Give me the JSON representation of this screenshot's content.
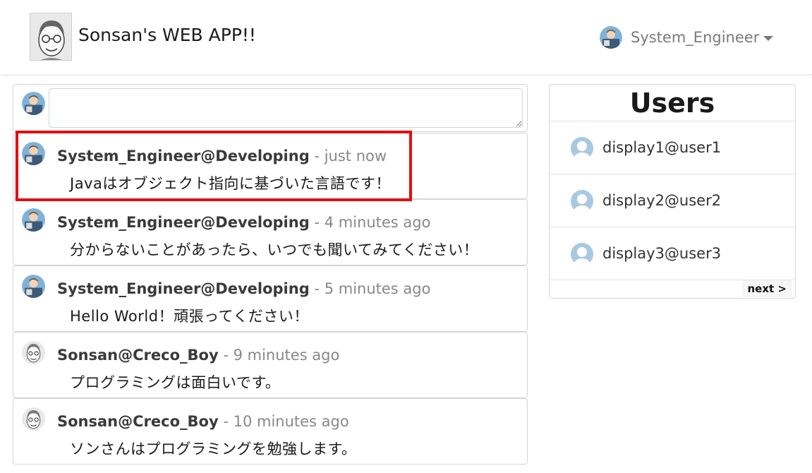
{
  "navbar": {
    "brand": "Sonsan's WEB APP!!",
    "user_name": "System_Engineer"
  },
  "compose": {
    "value": "",
    "placeholder": ""
  },
  "posts": [
    {
      "author": "System_Engineer@Developing",
      "separator": "-",
      "time": "just now",
      "body": "Javaはオブジェクト指向に基づいた言語です！",
      "avatar": "engineer-avatar"
    },
    {
      "author": "System_Engineer@Developing",
      "separator": "-",
      "time": "4 minutes ago",
      "body": "分からないことがあったら、いつでも聞いてみてください！",
      "avatar": "engineer-avatar"
    },
    {
      "author": "System_Engineer@Developing",
      "separator": "-",
      "time": "5 minutes ago",
      "body": "Hello World！頑張ってください！",
      "avatar": "engineer-avatar"
    },
    {
      "author": "Sonsan@Creco_Boy",
      "separator": "-",
      "time": "9 minutes ago",
      "body": "プログラミングは面白いです。",
      "avatar": "sonsan-avatar"
    },
    {
      "author": "Sonsan@Creco_Boy",
      "separator": "-",
      "time": "10 minutes ago",
      "body": "ソンさんはプログラミングを勉強します。",
      "avatar": "sonsan-avatar"
    }
  ],
  "users_panel": {
    "title": "Users",
    "users": [
      "display1@user1",
      "display2@user2",
      "display3@user3"
    ],
    "next_label": "next >"
  },
  "colors": {
    "highlight": "#e01010",
    "muted": "#888888",
    "user_avatar": "#a9c9e2"
  }
}
